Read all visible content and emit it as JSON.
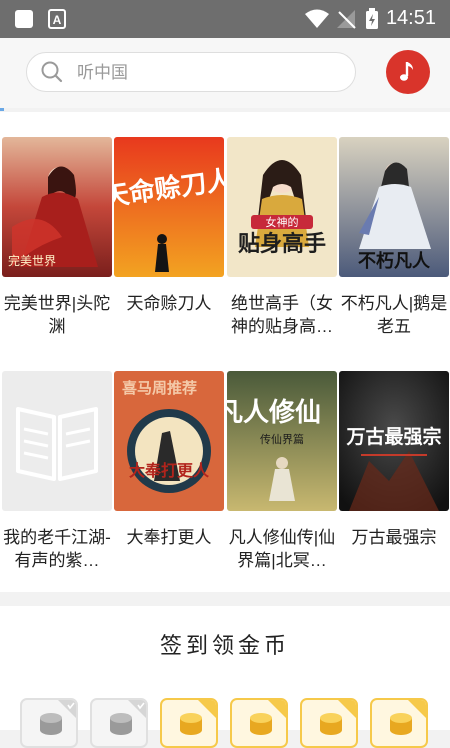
{
  "status_bar": {
    "time": "14:51"
  },
  "search": {
    "placeholder": "听中国"
  },
  "books": [
    {
      "title": "完美世界|头陀渊",
      "cover_color": "#b8352d"
    },
    {
      "title": "天命赊刀人",
      "cover_color": "#d8321f"
    },
    {
      "title": "绝世高手（女神的贴身高…",
      "cover_color": "#e8d8b0"
    },
    {
      "title": "不朽凡人|鹅是老五",
      "cover_color": "#7a8aa8"
    },
    {
      "title": "我的老千江湖-有声的紫…",
      "cover_color": "#ececec"
    },
    {
      "title": "大奉打更人",
      "cover_color": "#d86a3f"
    },
    {
      "title": "凡人修仙传|仙界篇|北冥…",
      "cover_color": "#5d6b3e"
    },
    {
      "title": "万古最强宗",
      "cover_color": "#1e1e1e"
    }
  ],
  "cover_texts": {
    "book1": "完美世界",
    "book2": "天命赊刀人",
    "book3_banner": "女神的",
    "book3_main": "贴身高手",
    "book4": "不朽凡人",
    "book6_banner": "喜马周推荐",
    "book6_main": "大奉打更人",
    "book7_main": "凡人修仙",
    "book7_sub": "传仙界篇",
    "book8": "万古最强宗"
  },
  "checkin": {
    "title": "签到领金币"
  },
  "colors": {
    "accent": "#d9342b",
    "coin": "#f6c94a",
    "done": "#e0e0e0"
  },
  "icons": [
    "search-icon",
    "music-note-icon",
    "coin-icon"
  ]
}
